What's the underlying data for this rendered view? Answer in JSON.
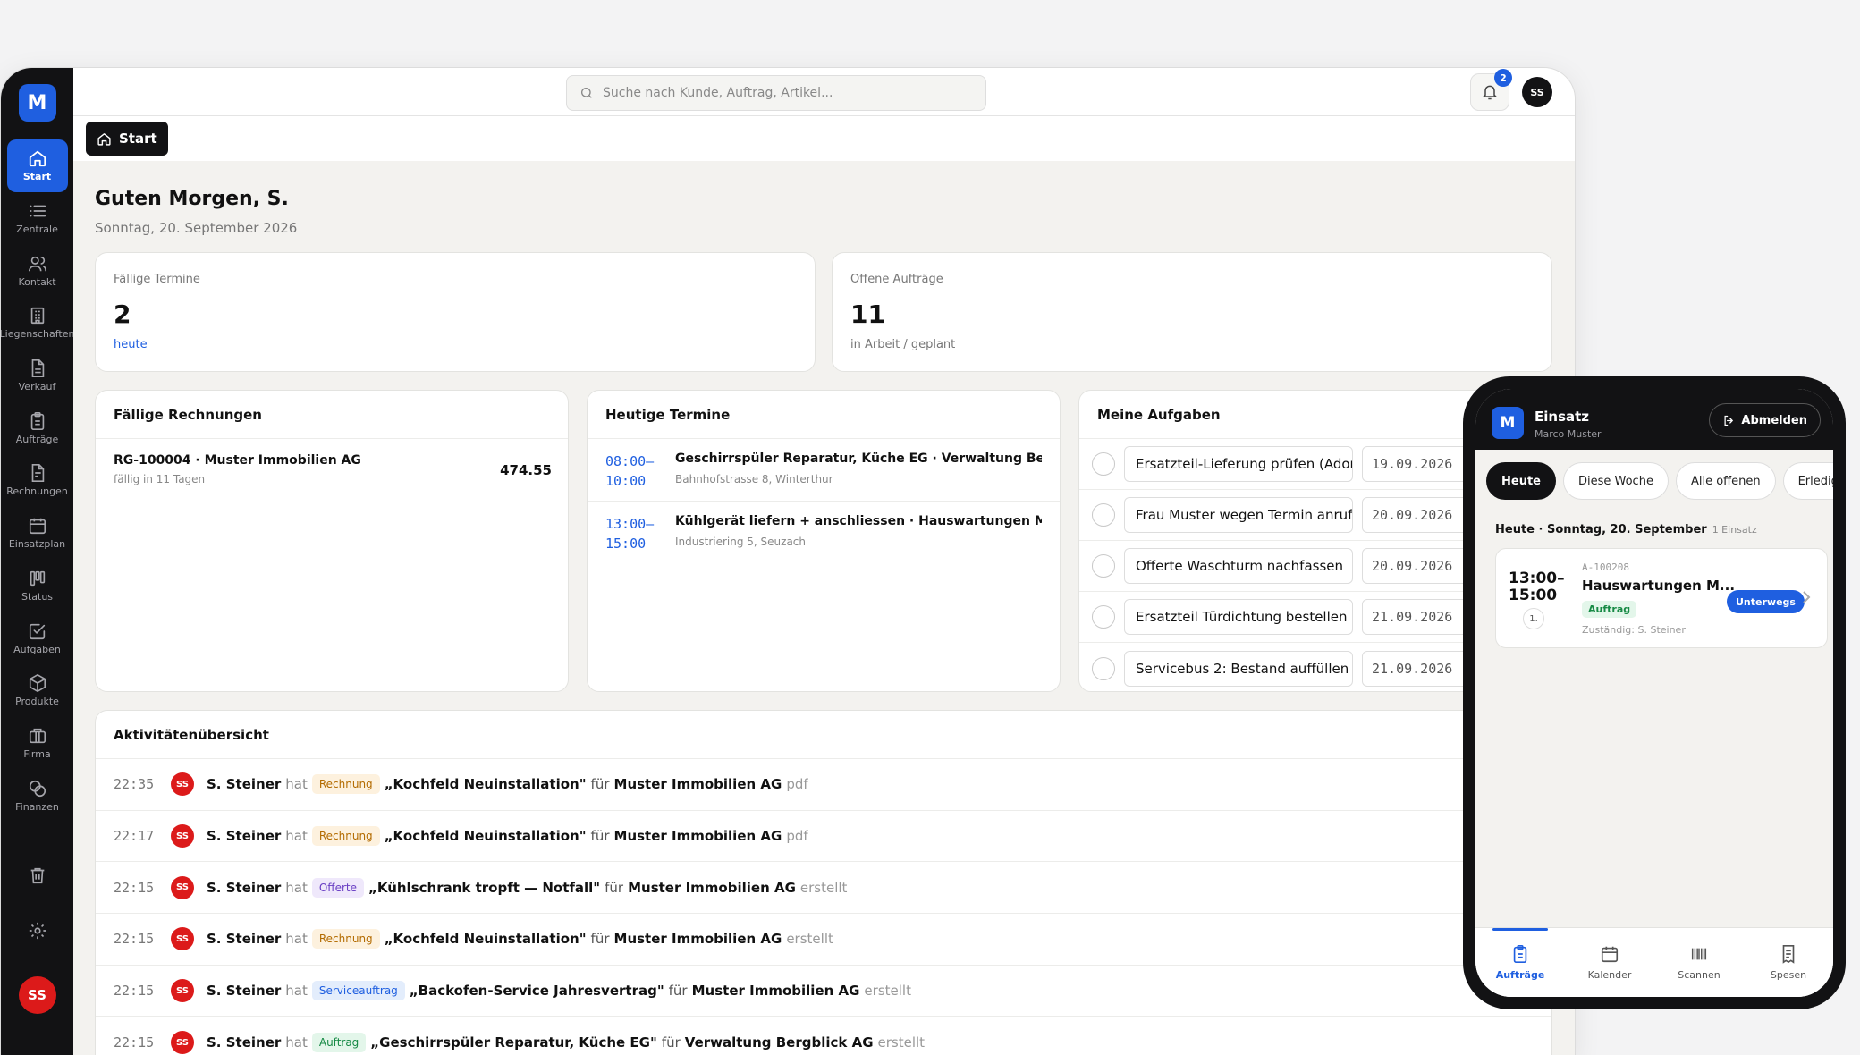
{
  "app": {
    "logo_letter": "M",
    "user_initials": "SS"
  },
  "sidebar": {
    "items": [
      {
        "label": "Start",
        "icon": "home-icon"
      },
      {
        "label": "Zentrale",
        "icon": "list-icon"
      },
      {
        "label": "Kontakt",
        "icon": "users-icon"
      },
      {
        "label": "Liegenschaften",
        "icon": "building-icon"
      },
      {
        "label": "Verkauf",
        "icon": "document-icon"
      },
      {
        "label": "Aufträge",
        "icon": "clipboard-icon"
      },
      {
        "label": "Rechnungen",
        "icon": "invoice-icon"
      },
      {
        "label": "Einsatzplan",
        "icon": "calendar-icon"
      },
      {
        "label": "Status",
        "icon": "kanban-icon"
      },
      {
        "label": "Aufgaben",
        "icon": "checkbox-icon"
      },
      {
        "label": "Produkte",
        "icon": "box-icon"
      },
      {
        "label": "Firma",
        "icon": "briefcase-icon"
      },
      {
        "label": "Finanzen",
        "icon": "coins-icon"
      }
    ]
  },
  "topbar": {
    "search_placeholder": "Suche nach Kunde, Auftrag, Artikel...",
    "notification_count": "2"
  },
  "tabs": {
    "start_label": "Start"
  },
  "dashboard": {
    "greeting": "Guten Morgen, S.",
    "date": "Sonntag, 20. September 2026",
    "stats": [
      {
        "label": "Fällige Termine",
        "value": "2",
        "sub": "heute"
      },
      {
        "label": "Offene Aufträge",
        "value": "11",
        "sub": "in Arbeit / geplant"
      }
    ],
    "invoices": {
      "title": "Fällige Rechnungen",
      "items": [
        {
          "title": "RG-100004 · Muster Immobilien AG",
          "sub": "fällig in 11 Tagen",
          "amount": "474.55"
        }
      ]
    },
    "appointments": {
      "title": "Heutige Termine",
      "items": [
        {
          "start": "08:00–",
          "end": "10:00",
          "title": "Geschirrspüler Reparatur, Küche EG · Verwaltung Bergbl…",
          "address": "Bahnhofstrasse 8, Winterthur"
        },
        {
          "start": "13:00–",
          "end": "15:00",
          "title": "Kühlgerät liefern + anschliessen · Hauswartungen Meier …",
          "address": "Industriering 5, Seuzach"
        }
      ]
    },
    "tasks": {
      "title": "Meine Aufgaben",
      "items": [
        {
          "title": "Ersatzteil-Lieferung prüfen (Adora",
          "date": "19.09.2026"
        },
        {
          "title": "Frau Muster wegen Termin anrufe",
          "date": "20.09.2026"
        },
        {
          "title": "Offerte Waschturm nachfassen",
          "date": "20.09.2026"
        },
        {
          "title": "Ersatzteil Türdichtung bestellen",
          "date": "21.09.2026"
        },
        {
          "title": "Servicebus 2: Bestand auffüllen",
          "date": "21.09.2026"
        }
      ]
    },
    "activity": {
      "title": "Aktivitätenübersicht",
      "hat": "hat",
      "fuer": "für",
      "items": [
        {
          "time": "22:35",
          "initials": "SS",
          "user": "S. Steiner",
          "tag": "Rechnung",
          "tag_bg": "#fdf1de",
          "tag_fg": "#b36b00",
          "object": "„Kochfeld Neuinstallation\"",
          "customer": "Muster Immobilien AG",
          "verb": "pdf"
        },
        {
          "time": "22:17",
          "initials": "SS",
          "user": "S. Steiner",
          "tag": "Rechnung",
          "tag_bg": "#fdf1de",
          "tag_fg": "#b36b00",
          "object": "„Kochfeld Neuinstallation\"",
          "customer": "Muster Immobilien AG",
          "verb": "pdf"
        },
        {
          "time": "22:15",
          "initials": "SS",
          "user": "S. Steiner",
          "tag": "Offerte",
          "tag_bg": "#efe8fb",
          "tag_fg": "#6a3fc4",
          "object": "„Kühlschrank tropft — Notfall\"",
          "customer": "Muster Immobilien AG",
          "verb": "erstellt"
        },
        {
          "time": "22:15",
          "initials": "SS",
          "user": "S. Steiner",
          "tag": "Rechnung",
          "tag_bg": "#fdf1de",
          "tag_fg": "#b36b00",
          "object": "„Kochfeld Neuinstallation\"",
          "customer": "Muster Immobilien AG",
          "verb": "erstellt"
        },
        {
          "time": "22:15",
          "initials": "SS",
          "user": "S. Steiner",
          "tag": "Serviceauftrag",
          "tag_bg": "#e3edfc",
          "tag_fg": "#1f5fe0",
          "object": "„Backofen-Service Jahresvertrag\"",
          "customer": "Muster Immobilien AG",
          "verb": "erstellt"
        },
        {
          "time": "22:15",
          "initials": "SS",
          "user": "S. Steiner",
          "tag": "Auftrag",
          "tag_bg": "#e3f6ea",
          "tag_fg": "#178a45",
          "object": "„Geschirrspüler Reparatur, Küche EG\"",
          "customer": "Verwaltung Bergblick AG",
          "verb": "erstellt"
        }
      ]
    }
  },
  "phone": {
    "logo_letter": "M",
    "title": "Einsatz",
    "user": "Marco Muster",
    "logout_label": "Abmelden",
    "filters": [
      "Heute",
      "Diese Woche",
      "Alle offenen",
      "Erledigt"
    ],
    "day_label": "Heute · Sonntag, 20. September",
    "day_count": "1 Einsatz",
    "job": {
      "time_start": "13:00–",
      "time_end": "15:00",
      "number": "1.",
      "id": "A-100208",
      "customer": "Hauswartungen M...",
      "tag": "Auftrag",
      "responsible": "Zuständig: S. Steiner",
      "status": "Unterwegs"
    },
    "nav": [
      {
        "label": "Aufträge",
        "icon": "clipboard-icon"
      },
      {
        "label": "Kalender",
        "icon": "calendar-icon"
      },
      {
        "label": "Scannen",
        "icon": "barcode-icon"
      },
      {
        "label": "Spesen",
        "icon": "receipt-icon"
      }
    ]
  }
}
